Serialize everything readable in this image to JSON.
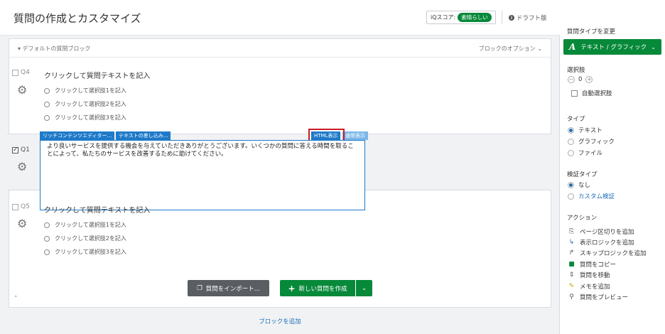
{
  "header": {
    "title": "質問の作成とカスタマイズ",
    "iq_label": "iQスコア:",
    "iq_value": "素晴らしい",
    "status": "ドラフト版"
  },
  "block": {
    "name": "デフォルトの質問ブロック",
    "options_label": "ブロックのオプション"
  },
  "questions": [
    {
      "id": "Q4",
      "text": "クリックして質問テキストを記入",
      "choices": [
        "クリックして選択肢1を記入",
        "クリックして選択肢2を記入",
        "クリックして選択肢3を記入"
      ]
    },
    {
      "id": "Q1",
      "checked": true,
      "editor_text": "より良いサービスを提供する機会を与えていただきありがとうございます。いくつかの質問に答える時間を取ることによって、私たちのサービスを改善するために助けてください。",
      "tabs": [
        "リッチコンテンツエディター...",
        "テキストの差し込み..."
      ],
      "html_tab": "HTML表示",
      "normal_tab": "通常表示"
    },
    {
      "id": "Q5",
      "text": "クリックして質問テキストを記入",
      "choices": [
        "クリックして選択肢1を記入",
        "クリックして選択肢2を記入",
        "クリックして選択肢3を記入"
      ]
    }
  ],
  "buttons": {
    "import": "質問をインポート...",
    "new_question": "新しい質問を作成",
    "add_block": "ブロックを追加"
  },
  "sidebar": {
    "change_type_heading": "質問タイプを変更",
    "type_label": "テキスト / グラフィック",
    "choices_heading": "選択肢",
    "choices_count": "0",
    "auto_choices": "自動選択肢",
    "type_heading": "タイプ",
    "types": [
      "テキスト",
      "グラフィック",
      "ファイル"
    ],
    "selected_type": "テキスト",
    "validation_heading": "検証タイプ",
    "validation": [
      "なし",
      "カスタム検証"
    ],
    "actions_heading": "アクション",
    "actions": [
      {
        "label": "ページ区切りを追加",
        "icon": "page-break-icon"
      },
      {
        "label": "表示ロジックを追加",
        "icon": "display-logic-icon"
      },
      {
        "label": "スキップロジックを追加",
        "icon": "skip-logic-icon"
      },
      {
        "label": "質問をコピー",
        "icon": "copy-icon"
      },
      {
        "label": "質問を移動",
        "icon": "move-icon"
      },
      {
        "label": "メモを追加",
        "icon": "note-icon"
      },
      {
        "label": "質問をプレビュー",
        "icon": "preview-icon"
      }
    ]
  },
  "colors": {
    "accent_green": "#07893a",
    "editor_blue": "#1f7ac9",
    "highlight_red": "#c91d26"
  }
}
